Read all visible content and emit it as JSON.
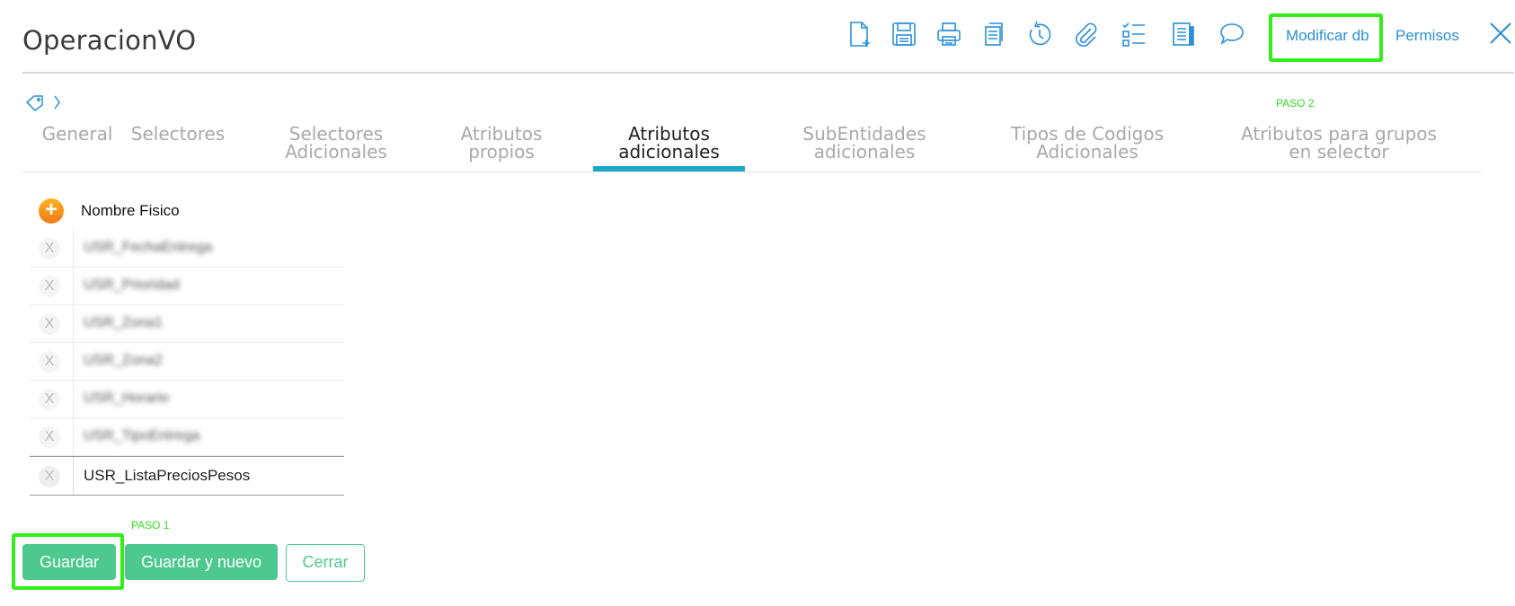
{
  "header": {
    "title": "OperacionVO",
    "toolbar": [
      {
        "name": "new-document-icon"
      },
      {
        "name": "save-icon"
      },
      {
        "name": "print-icon"
      },
      {
        "name": "copy-icon"
      },
      {
        "name": "history-icon"
      },
      {
        "name": "attachment-icon"
      },
      {
        "name": "checklist-icon"
      },
      {
        "name": "report-icon"
      },
      {
        "name": "comment-icon"
      }
    ],
    "modificar_db": "Modificar db",
    "permisos": "Permisos"
  },
  "annotations": {
    "paso1": "PASO 1",
    "paso2": "PASO 2",
    "highlight_color": "#33ee1a"
  },
  "tabs": [
    {
      "line1": "General",
      "line2": ""
    },
    {
      "line1": "Selectores",
      "line2": ""
    },
    {
      "line1": "Selectores",
      "line2": "Adicionales"
    },
    {
      "line1": "Atributos",
      "line2": "propios"
    },
    {
      "line1": "Atributos",
      "line2": "adicionales"
    },
    {
      "line1": "SubEntidades",
      "line2": "adicionales"
    },
    {
      "line1": "Tipos de Codigos",
      "line2": "Adicionales"
    },
    {
      "line1": "Atributos para grupos",
      "line2": "en selector"
    }
  ],
  "active_tab": "Atributos adicionales",
  "table": {
    "column_header": "Nombre Fisico",
    "rows": [
      {
        "value": "USR_FechaEntrega",
        "blurred": true
      },
      {
        "value": "USR_Prioridad",
        "blurred": true
      },
      {
        "value": "USR_Zona1",
        "blurred": true
      },
      {
        "value": "USR_Zona2",
        "blurred": true
      },
      {
        "value": "USR_Horario",
        "blurred": true
      },
      {
        "value": "USR_TipoEntrega",
        "blurred": true
      },
      {
        "value": "USR_ListaPreciosPesos",
        "blurred": false
      }
    ],
    "remove_label": "X"
  },
  "buttons": {
    "guardar": "Guardar",
    "guardar_nuevo": "Guardar y nuevo",
    "cerrar": "Cerrar"
  },
  "colors": {
    "accent": "#2a8fd8",
    "tab_underline": "#1ea7c8",
    "primary_button": "#4dc98f"
  }
}
